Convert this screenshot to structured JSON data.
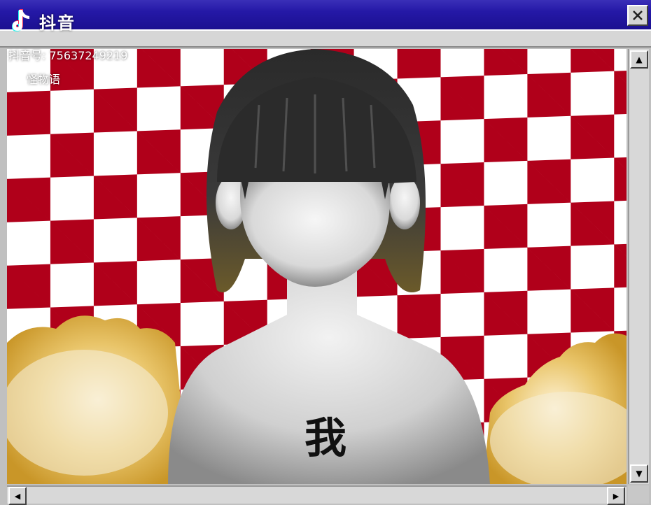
{
  "window": {
    "close_symbol": "✕"
  },
  "watermark": {
    "app_name": "抖音",
    "user_id": "抖音号: 75637249219",
    "search_text": "怪物语",
    "logo_icon": "tiktok-logo-icon",
    "search_icon": "search-icon"
  },
  "artwork": {
    "chest_text": "我",
    "checker_colors": [
      "#b0001a",
      "#ffffff"
    ],
    "cloud_color": "#d8b24a"
  },
  "scrollbars": {
    "up_arrow": "▲",
    "down_arrow": "▼",
    "left_arrow": "◀",
    "right_arrow": "▶"
  }
}
